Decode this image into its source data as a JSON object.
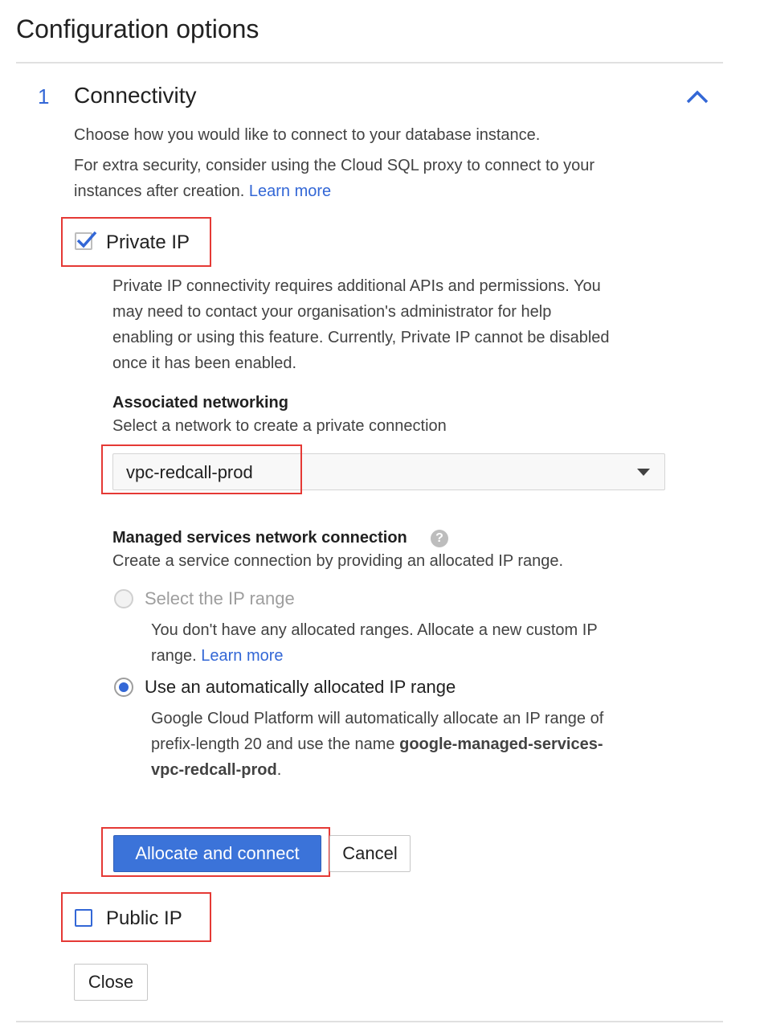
{
  "page": {
    "title": "Configuration options"
  },
  "step": {
    "number": "1",
    "title": "Connectivity",
    "collapse_icon": "chevron-up-icon",
    "desc1": "Choose how you would like to connect to your database instance.",
    "desc2_line1": "For extra security, consider using the Cloud SQL proxy to connect to your",
    "desc2_line2": "instances after creation.",
    "learn_more": "Learn more"
  },
  "private_ip": {
    "label": "Private IP",
    "checked": true,
    "desc": [
      "Private IP connectivity requires additional APIs and permissions. You",
      "may need to contact your organisation's administrator for help",
      "enabling or using this feature. Currently, Private IP cannot be disabled",
      "once it has been enabled."
    ],
    "networking_title": "Associated networking",
    "networking_sub": "Select a network to create a private connection",
    "network_selected": "vpc-redcall-prod",
    "managed_title": "Managed services network connection",
    "managed_sub": "Create a service connection by providing an allocated IP range.",
    "option_select_range": "Select the IP range",
    "option_select_desc1": "You don't have any allocated ranges. Allocate a new custom IP",
    "option_select_desc2": "range.",
    "option_learn_more": "Learn more",
    "option_auto": "Use an automatically allocated IP range",
    "auto_desc1": "Google Cloud Platform will automatically allocate an IP range of",
    "auto_desc2_pre": "prefix-length 20 and use the name",
    "auto_desc2_bold": "google-managed-services-",
    "auto_desc3_bold": "vpc-redcall-prod",
    "auto_desc3_post": ".",
    "allocate_button": "Allocate and connect",
    "cancel_button": "Cancel"
  },
  "public_ip": {
    "label": "Public IP",
    "checked": false
  },
  "close_button": "Close",
  "colors": {
    "accent": "#3367d6",
    "primary_button": "#3b73d9",
    "highlight": "#e53935"
  }
}
